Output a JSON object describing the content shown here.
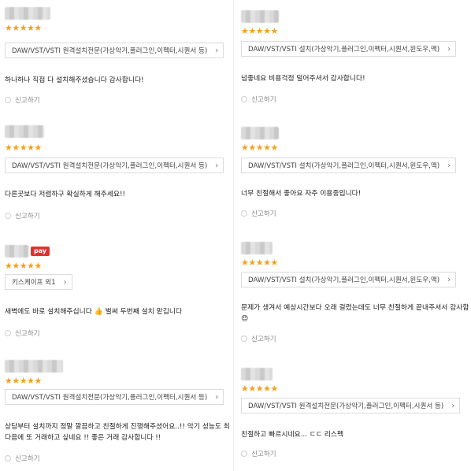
{
  "report_label": "신고하기",
  "star_text": "★★★★★",
  "reviews_left": [
    {
      "option": "DAW/VST/VSTI 원격설치전문(가상악기,플러그인,이펙터,시퀀서 등)",
      "text": "하나하나 직접 다 설치해주셨습니다 감사합니다!"
    },
    {
      "option": "DAW/VST/VSTI 원격설치전문(가상악기,플러그인,이펙터,시퀀서 등)",
      "text": "다른곳보다 저렴하구 확실하게 해주세요!!"
    },
    {
      "badge": "pay",
      "option": "키스케이프 외1",
      "text_a": "새벽에도 바로 설치해주십니다",
      "emoji": "👍",
      "text_b": "벌써 두번째 설치 맡깁니다"
    },
    {
      "option": "DAW/VST/VSTI 원격설치전문(가상악기,플러그인,이펙터,시퀀서 등)",
      "text_line1": "상담부터 설치까지 정말 깔끔하고 친절하게 진행해주셨어요..!! 악기 성능도 최",
      "text_line2": "다음에 또 거래하고 싶네요 !! 좋은 거래 감사합니다 !!"
    }
  ],
  "reviews_right": [
    {
      "option": "DAW/VST/VSTI 설치(가상악기,플러그인,이펙터,시퀀서,윈도우,맥)",
      "text": "넘좋네요 비용걱정 덜어주셔서 감사합니다!"
    },
    {
      "option": "DAW/VST/VSTI 설치(가상악기,플러그인,이펙터,시퀀서,윈도우,맥)",
      "text": "너무 친절해서 좋아요 자주 이용중입니다!"
    },
    {
      "option": "DAW/VST/VSTI 설치(가상악기,플러그인,이펙터,시퀀서,윈도우,맥)",
      "text": "문제가 생겨서 예상시간보다 오래 걸렸는데도 너무 친절하게 끝내주셔서 감사합",
      "emoji": "😍"
    },
    {
      "option": "DAW/VST/VSTI 원격설치전문(가상악기,플러그인,이펙터,시퀀서 등)",
      "text": "친절하고 빠르시네요... ㄷㄷ 리스펙"
    }
  ]
}
